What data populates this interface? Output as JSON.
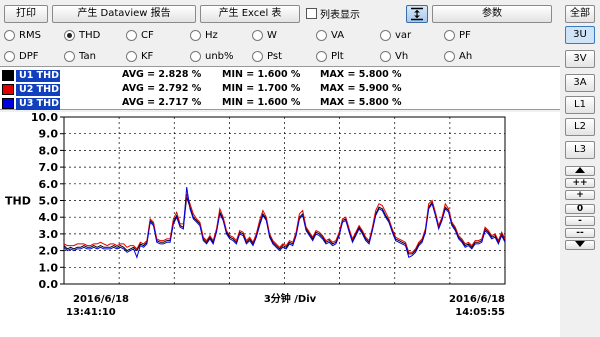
{
  "toolbar": {
    "print": "打印",
    "dataview": "产生 Dataview 报告",
    "excel": "产生 Excel 表",
    "list_display": "列表显示",
    "scale_icon": "fit-vertical-icon",
    "params": "参数"
  },
  "radios": [
    {
      "label": "RMS",
      "selected": false
    },
    {
      "label": "THD",
      "selected": true
    },
    {
      "label": "CF",
      "selected": false
    },
    {
      "label": "Hz",
      "selected": false
    },
    {
      "label": "W",
      "selected": false
    },
    {
      "label": "VA",
      "selected": false
    },
    {
      "label": "var",
      "selected": false
    },
    {
      "label": "PF",
      "selected": false
    },
    {
      "label": "DPF",
      "selected": false
    },
    {
      "label": "Tan",
      "selected": false
    },
    {
      "label": "KF",
      "selected": false
    },
    {
      "label": "unb%",
      "selected": false
    },
    {
      "label": "Pst",
      "selected": false
    },
    {
      "label": "Plt",
      "selected": false
    },
    {
      "label": "Vh",
      "selected": false
    },
    {
      "label": "Ah",
      "selected": false
    }
  ],
  "legend": [
    {
      "name": "U1 THD",
      "swatch": "#000000",
      "avg": "AVG = 2.828 %",
      "min": "MIN = 1.600 %",
      "max": "MAX = 5.800 %"
    },
    {
      "name": "U2 THD",
      "swatch": "#e00000",
      "avg": "AVG = 2.792 %",
      "min": "MIN = 1.700 %",
      "max": "MAX = 5.900 %"
    },
    {
      "name": "U3 THD",
      "swatch": "#0000e0",
      "avg": "AVG = 2.717 %",
      "min": "MIN = 1.600 %",
      "max": "MAX = 5.800 %"
    }
  ],
  "side": {
    "all": "全部",
    "buttons": [
      "3U",
      "3V",
      "3A",
      "L1",
      "L2",
      "L3"
    ],
    "active": "3U",
    "zoom": [
      "++",
      "+",
      "0",
      "-",
      "--"
    ],
    "up_icon": "triangle-up-icon",
    "down_icon": "triangle-down-icon"
  },
  "chart_data": {
    "type": "line",
    "ylabel": "THD",
    "xlabel": "3分钟 /Div",
    "x_start": "2016/6/18",
    "x_start_time": "13:41:10",
    "x_end": "2016/6/18",
    "x_end_time": "14:05:55",
    "ylim": [
      0,
      10
    ],
    "yticks": [
      "0.0",
      "1.0",
      "2.0",
      "3.0",
      "4.0",
      "5.0",
      "6.0",
      "7.0",
      "8.0",
      "9.0",
      "10.0"
    ],
    "grid": "dashed",
    "series": [
      {
        "name": "U1 THD",
        "color": "#000000",
        "values": [
          2.3,
          2.1,
          2.2,
          2.1,
          2.2,
          2.2,
          2.3,
          2.2,
          2.2,
          2.3,
          2.2,
          2.3,
          2.2,
          2.2,
          2.2,
          2.3,
          2.2,
          2.3,
          2.2,
          2.0,
          2.1,
          2.2,
          2.0,
          2.4,
          2.3,
          2.5,
          3.8,
          3.6,
          2.6,
          2.5,
          2.5,
          2.6,
          2.6,
          3.7,
          4.1,
          3.5,
          3.4,
          5.2,
          4.6,
          4.0,
          3.8,
          3.6,
          2.7,
          2.5,
          2.8,
          2.5,
          3.2,
          4.3,
          3.9,
          3.1,
          2.8,
          2.7,
          2.5,
          3.1,
          3.0,
          2.5,
          2.7,
          2.4,
          2.9,
          3.6,
          4.2,
          3.9,
          2.9,
          2.5,
          2.3,
          2.1,
          2.3,
          2.2,
          2.5,
          2.4,
          3.0,
          4.0,
          4.2,
          3.3,
          3.0,
          2.7,
          3.1,
          3.0,
          2.8,
          2.5,
          2.6,
          2.4,
          2.5,
          3.0,
          3.8,
          3.9,
          3.2,
          2.6,
          3.0,
          3.4,
          3.1,
          2.7,
          2.5,
          3.3,
          4.2,
          4.6,
          4.5,
          4.1,
          3.8,
          3.2,
          2.7,
          2.6,
          2.5,
          2.4,
          1.8,
          1.8,
          2.0,
          2.4,
          2.6,
          3.2,
          4.6,
          4.9,
          4.2,
          3.4,
          3.9,
          4.6,
          4.4,
          3.6,
          3.3,
          2.8,
          2.6,
          2.3,
          2.4,
          2.2,
          2.5,
          2.5,
          2.6,
          3.3,
          3.1,
          2.8,
          2.9,
          2.5,
          3.0,
          2.6
        ]
      },
      {
        "name": "U2 THD",
        "color": "#e00000",
        "values": [
          2.4,
          2.3,
          2.3,
          2.3,
          2.4,
          2.4,
          2.4,
          2.3,
          2.3,
          2.4,
          2.4,
          2.5,
          2.4,
          2.3,
          2.4,
          2.4,
          2.3,
          2.4,
          2.4,
          2.2,
          2.3,
          2.3,
          2.1,
          2.5,
          2.4,
          2.6,
          3.9,
          3.7,
          2.7,
          2.6,
          2.6,
          2.7,
          2.7,
          3.9,
          4.3,
          3.6,
          3.6,
          5.4,
          4.8,
          4.2,
          3.9,
          3.7,
          2.8,
          2.6,
          2.9,
          2.6,
          3.3,
          4.5,
          4.0,
          3.2,
          2.9,
          2.8,
          2.6,
          3.2,
          3.1,
          2.6,
          2.8,
          2.5,
          3.0,
          3.8,
          4.4,
          4.0,
          3.0,
          2.6,
          2.4,
          2.2,
          2.4,
          2.3,
          2.6,
          2.5,
          3.1,
          4.2,
          4.4,
          3.4,
          3.1,
          2.8,
          3.2,
          3.1,
          2.9,
          2.6,
          2.7,
          2.5,
          2.6,
          3.1,
          3.9,
          4.0,
          3.3,
          2.7,
          3.1,
          3.5,
          3.2,
          2.8,
          2.6,
          3.4,
          4.4,
          4.8,
          4.7,
          4.3,
          3.9,
          3.3,
          2.8,
          2.7,
          2.6,
          2.5,
          1.9,
          1.9,
          2.1,
          2.5,
          2.7,
          3.3,
          4.8,
          5.0,
          4.3,
          3.5,
          4.0,
          4.8,
          4.5,
          3.7,
          3.4,
          2.9,
          2.7,
          2.4,
          2.5,
          2.3,
          2.6,
          2.6,
          2.7,
          3.4,
          3.2,
          2.9,
          3.0,
          2.6,
          3.1,
          2.7
        ]
      },
      {
        "name": "U3 THD",
        "color": "#0000e0",
        "values": [
          2.2,
          2.0,
          2.1,
          2.0,
          2.1,
          2.1,
          2.2,
          2.1,
          2.1,
          2.2,
          2.1,
          2.2,
          2.1,
          2.1,
          2.1,
          2.2,
          2.1,
          2.2,
          2.1,
          1.9,
          2.0,
          2.1,
          1.6,
          2.3,
          2.2,
          2.4,
          3.7,
          3.5,
          2.5,
          2.4,
          2.4,
          2.5,
          2.5,
          3.6,
          4.0,
          3.4,
          3.3,
          5.8,
          4.5,
          3.9,
          3.7,
          3.5,
          2.6,
          2.4,
          2.7,
          2.4,
          3.1,
          4.2,
          3.8,
          3.0,
          2.7,
          2.6,
          2.4,
          3.0,
          2.9,
          2.4,
          2.6,
          2.3,
          2.8,
          3.5,
          4.1,
          3.8,
          2.8,
          2.4,
          2.2,
          2.0,
          2.2,
          2.1,
          2.4,
          2.3,
          2.9,
          3.9,
          4.1,
          3.2,
          2.9,
          2.6,
          3.0,
          2.9,
          2.7,
          2.4,
          2.5,
          2.3,
          2.4,
          2.9,
          3.7,
          3.8,
          3.1,
          2.5,
          2.9,
          3.3,
          3.0,
          2.6,
          2.4,
          3.2,
          4.1,
          4.5,
          4.4,
          4.0,
          3.7,
          3.1,
          2.6,
          2.5,
          2.4,
          2.3,
          1.6,
          1.7,
          1.9,
          2.3,
          2.5,
          3.1,
          4.5,
          4.8,
          4.1,
          3.3,
          3.8,
          4.5,
          4.3,
          3.5,
          3.2,
          2.7,
          2.5,
          2.2,
          2.3,
          2.1,
          2.4,
          2.4,
          2.5,
          3.2,
          3.0,
          2.7,
          2.8,
          2.4,
          2.9,
          2.5
        ]
      }
    ]
  }
}
